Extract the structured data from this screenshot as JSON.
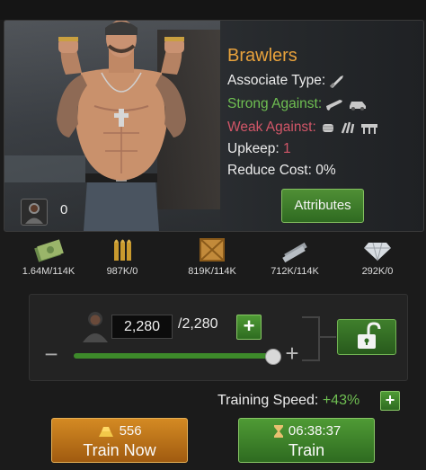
{
  "unit": {
    "name": "Brawlers",
    "associate_type_label": "Associate Type:",
    "strong_against_label": "Strong Against:",
    "weak_against_label": "Weak Against:",
    "upkeep_label": "Upkeep:",
    "upkeep_value": "1",
    "reduce_cost_label": "Reduce Cost:",
    "reduce_cost_value": "0%",
    "associate_count": "0",
    "attributes_label": "Attributes",
    "associate_type_icon": "knife-icon",
    "strong_against_icons": [
      "rifle-icon",
      "car-icon"
    ],
    "weak_against_icons": [
      "fist-icon",
      "claw-icon",
      "barricade-icon"
    ]
  },
  "resources": [
    {
      "icon": "cash-icon",
      "value": "1.64M/114K"
    },
    {
      "icon": "bullets-icon",
      "value": "987K/0"
    },
    {
      "icon": "crate-icon",
      "value": "819K/114K"
    },
    {
      "icon": "metal-bars-icon",
      "value": "712K/114K"
    },
    {
      "icon": "diamond-icon",
      "value": "292K/0"
    }
  ],
  "training": {
    "quantity": "2,280",
    "max": "/2,280",
    "slider_fraction": 1.0,
    "speed_label": "Training Speed:",
    "speed_value": "+43%"
  },
  "buttons": {
    "train_now_cost": "556",
    "train_now_label": "Train Now",
    "train_time": "06:38:37",
    "train_label": "Train"
  },
  "colors": {
    "accent_orange": "#e8a23c",
    "strong_green": "#6fbf52",
    "weak_red": "#d25668"
  }
}
